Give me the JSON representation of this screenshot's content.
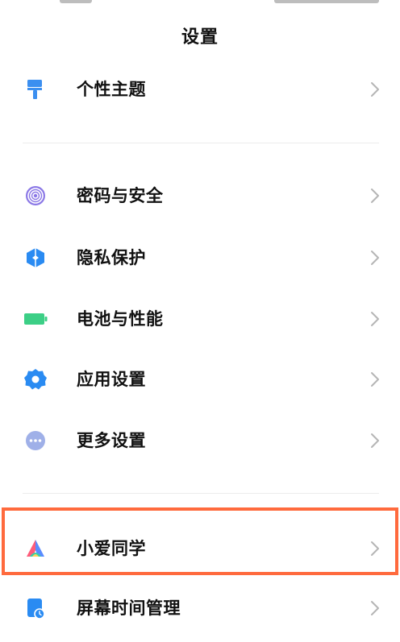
{
  "header": {
    "title": "设置"
  },
  "sections": [
    {
      "items": [
        {
          "label": "个性主题",
          "icon": "paint-roller-icon"
        }
      ]
    },
    {
      "items": [
        {
          "label": "密码与安全",
          "icon": "fingerprint-icon"
        },
        {
          "label": "隐私保护",
          "icon": "privacy-shield-icon"
        },
        {
          "label": "电池与性能",
          "icon": "battery-icon"
        },
        {
          "label": "应用设置",
          "icon": "gear-icon"
        },
        {
          "label": "更多设置",
          "icon": "more-dots-icon"
        }
      ]
    },
    {
      "items": [
        {
          "label": "小爱同学",
          "icon": "xiaoai-assistant-icon",
          "highlighted": true
        },
        {
          "label": "屏幕时间管理",
          "icon": "screen-time-icon"
        }
      ]
    }
  ],
  "colors": {
    "theme_icon": "#3b8ff0",
    "fingerprint_icon": "#8b78e6",
    "privacy_icon": "#2a8bf2",
    "battery_icon": "#3ccf86",
    "gear_icon": "#2a8bf2",
    "more_icon": "#9fb0e8",
    "highlight_border": "#ff6a3d",
    "chevron": "#b5b5b5"
  }
}
